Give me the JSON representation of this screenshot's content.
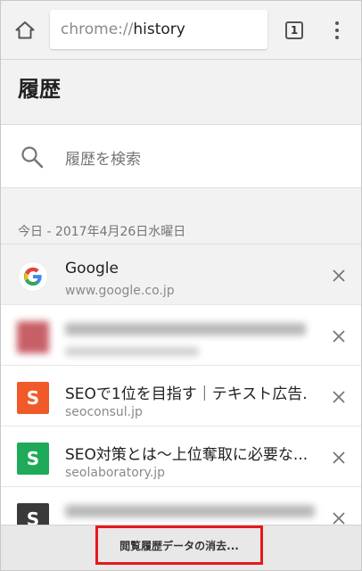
{
  "toolbar": {
    "url_scheme": "chrome://",
    "url_host": "history",
    "tab_count": "1"
  },
  "page": {
    "title": "履歴"
  },
  "search": {
    "placeholder": "履歴を検索"
  },
  "date_header": "今日 - 2017年4月26日水曜日",
  "history_items": [
    {
      "title": "Google",
      "url": "www.google.co.jp",
      "favicon": "google-icon",
      "favicon_color": "#ffffff",
      "selected": true
    },
    {
      "title": "",
      "url": "",
      "favicon": "red-favicon",
      "favicon_color": "#b01c26",
      "blurred": true
    },
    {
      "title": "SEOで1位を目指す｜テキスト広告.",
      "url": "seoconsul.jp",
      "favicon": "S",
      "favicon_color": "#f05a28"
    },
    {
      "title": "SEO対策とは～上位奪取に必要な...",
      "url": "seolaboratory.jp",
      "favicon": "S",
      "favicon_color": "#1faa59"
    },
    {
      "title": "",
      "url": "",
      "favicon": "S",
      "favicon_color": "#3a3a3a",
      "blurred": true
    }
  ],
  "bottom": {
    "clear_label": "閲覧履歴データの消去..."
  },
  "colors": {
    "highlight": "#e8181c",
    "chrome_bg": "#f2f2f2"
  }
}
